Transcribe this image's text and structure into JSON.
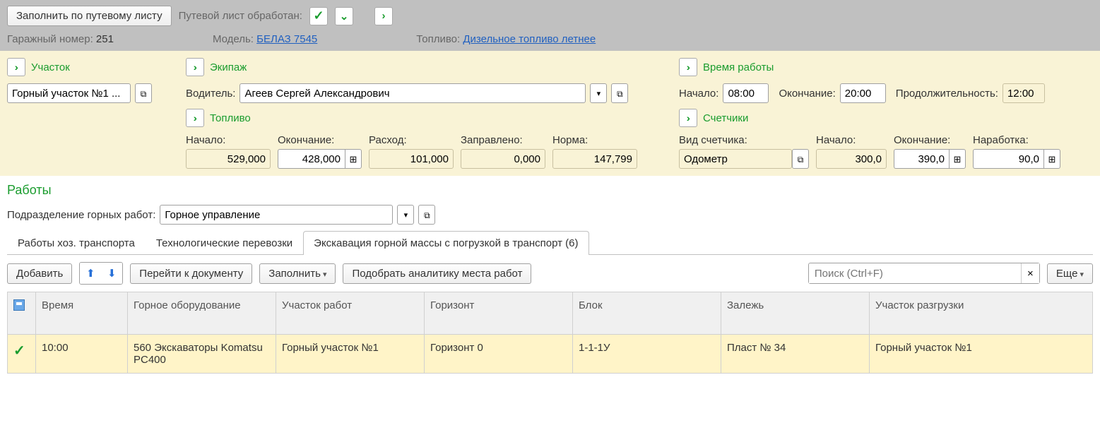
{
  "top": {
    "fill_btn": "Заполнить по путевому листу",
    "processed_label": "Путевой лист обработан:",
    "garage_label": "Гаражный номер:",
    "garage_value": "251",
    "model_label": "Модель:",
    "model_value": "БЕЛАЗ 7545",
    "fuel_label": "Топливо:",
    "fuel_value": "Дизельное топливо летнее"
  },
  "section_area": {
    "title": "Участок",
    "value": "Горный участок №1 ..."
  },
  "section_crew": {
    "title": "Экипаж",
    "driver_label": "Водитель:",
    "driver_value": "Агеев Сергей Александрович"
  },
  "section_fuel": {
    "title": "Топливо",
    "start_label": "Начало:",
    "start_value": "529,000",
    "end_label": "Окончание:",
    "end_value": "428,000",
    "consumption_label": "Расход:",
    "consumption_value": "101,000",
    "refueled_label": "Заправлено:",
    "refueled_value": "0,000",
    "norm_label": "Норма:",
    "norm_value": "147,799"
  },
  "section_time": {
    "title": "Время работы",
    "start_label": "Начало:",
    "start_value": "08:00",
    "end_label": "Окончание:",
    "end_value": "20:00",
    "duration_label": "Продолжительность:",
    "duration_value": "12:00"
  },
  "section_counters": {
    "title": "Счетчики",
    "type_label": "Вид счетчика:",
    "type_value": "Одометр",
    "start_label": "Начало:",
    "start_value": "300,0",
    "end_label": "Окончание:",
    "end_value": "390,0",
    "output_label": "Наработка:",
    "output_value": "90,0"
  },
  "works": {
    "title": "Работы",
    "division_label": "Подразделение горных работ:",
    "division_value": "Горное управление",
    "tabs": [
      {
        "label": "Работы хоз. транспорта"
      },
      {
        "label": "Технологические перевозки"
      },
      {
        "label": "Экскавация горной массы с погрузкой в транспорт (6)"
      }
    ],
    "toolbar": {
      "add": "Добавить",
      "goto_doc": "Перейти к документу",
      "fill": "Заполнить",
      "pick_analytics": "Подобрать аналитику места работ",
      "more": "Еще",
      "search_placeholder": "Поиск (Ctrl+F)"
    },
    "columns": [
      "",
      "Время",
      "Горное оборудование",
      "Участок работ",
      "Горизонт",
      "Блок",
      "Залежь",
      "Участок разгрузки"
    ],
    "rows": [
      {
        "time": "10:00",
        "equipment": "560 Экскаваторы Komatsu PC400",
        "area": "Горный участок №1",
        "horizon": "Горизонт 0",
        "block": "1-1-1У",
        "deposit": "Пласт № 34",
        "unload_area": "Горный участок №1"
      }
    ]
  }
}
